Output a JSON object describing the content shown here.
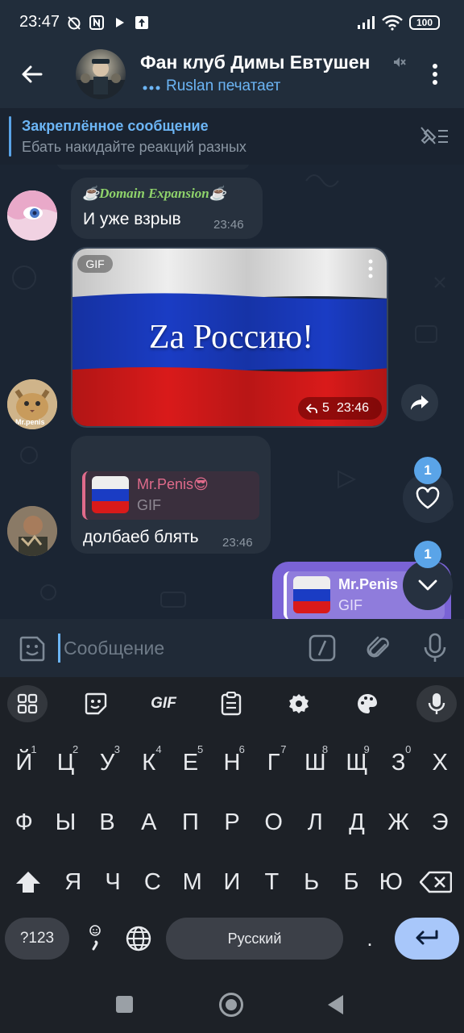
{
  "status_bar": {
    "time": "23:47",
    "battery": "100"
  },
  "header": {
    "title": "Фан клуб Димы Евтушен",
    "typing": "Ruslan печатает"
  },
  "pinned": {
    "title": "Закреплённое сообщение",
    "text": "Ебать накидайте реакций разных"
  },
  "messages": {
    "m1": {
      "sender": "☕Domain Expansion☕",
      "text": "И уже взрыв",
      "time": "23:46"
    },
    "m2": {
      "badge": "GIF",
      "caption": "Za Россию!",
      "reply_count": "5",
      "time": "23:46"
    },
    "m3": {
      "reply_name": "Mr.Penis😎",
      "reply_type": "GIF",
      "text": "долбаеб блять",
      "time": "23:46"
    },
    "m4": {
      "reply_name": "Mr.Penis",
      "reply_type": "GIF"
    },
    "avatar_label": "Mr.penis"
  },
  "fab": {
    "reactions_count": "1",
    "scroll_count": "1"
  },
  "input": {
    "placeholder": "Сообщение"
  },
  "keyboard": {
    "gif_label": "GIF",
    "row1": [
      "Й",
      "Ц",
      "У",
      "К",
      "Е",
      "Н",
      "Г",
      "Ш",
      "Щ",
      "З",
      "Х"
    ],
    "row1_hints": [
      "1",
      "2",
      "3",
      "4",
      "5",
      "6",
      "7",
      "8",
      "9",
      "0",
      ""
    ],
    "row2": [
      "Ф",
      "Ы",
      "В",
      "А",
      "П",
      "Р",
      "О",
      "Л",
      "Д",
      "Ж",
      "Э"
    ],
    "row3": [
      "Я",
      "Ч",
      "С",
      "М",
      "И",
      "Т",
      "Ь",
      "Б",
      "Ю"
    ],
    "sym_label": "?123",
    "space_label": "Русский",
    "period": "."
  },
  "colors": {
    "accent": "#6cb5f5",
    "outgoing": "#7a63d6",
    "reply_bar": "#e06b8b"
  }
}
